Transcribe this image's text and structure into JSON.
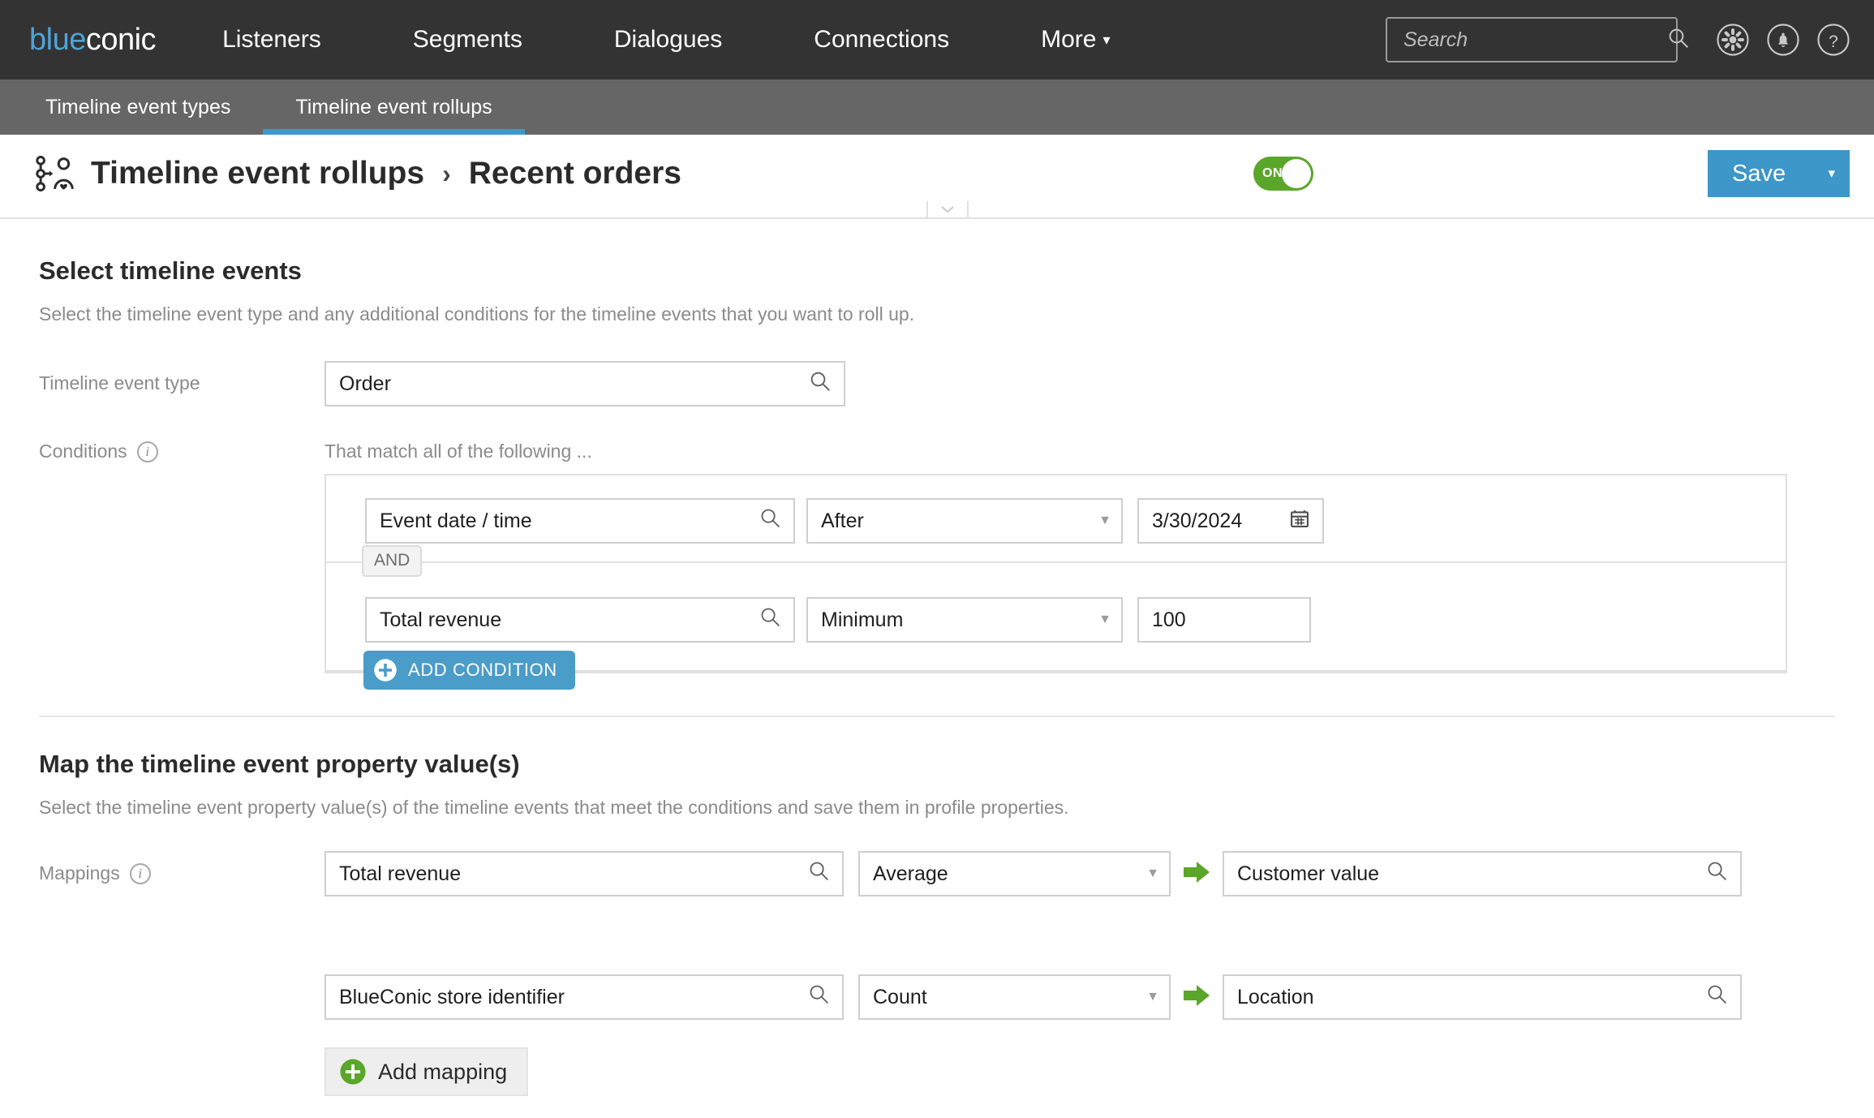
{
  "topnav": {
    "logo_blue": "blue",
    "logo_rest": "conic",
    "links": [
      {
        "label": "Listeners"
      },
      {
        "label": "Segments"
      },
      {
        "label": "Dialogues"
      },
      {
        "label": "Connections"
      },
      {
        "label": "More"
      }
    ],
    "more_caret": "▾",
    "search": {
      "value": "",
      "placeholder": "Search",
      "icon": "search-icon"
    },
    "icons": [
      "gear-icon",
      "bell-icon",
      "help-icon"
    ]
  },
  "tabs": [
    {
      "label": "Timeline event types",
      "active": false
    },
    {
      "label": "Timeline event rollups",
      "active": true
    }
  ],
  "page_header": {
    "breadcrumb_root": "Timeline event rollups",
    "breadcrumb_sep": "›",
    "breadcrumb_current": "Recent orders",
    "toggle": {
      "label": "ON",
      "state": "on"
    },
    "save": {
      "label": "Save",
      "caret": "▾"
    }
  },
  "select_events": {
    "title": "Select timeline events",
    "subtitle": "Select the timeline event type and any additional conditions for the timeline events that you want to roll up.",
    "event_type": {
      "label": "Timeline event type",
      "value": "Order"
    },
    "conditions": {
      "label": "Conditions",
      "match_text": "That match all of the following ...",
      "joiner": "AND",
      "rows": [
        {
          "property": "Event date / time",
          "operator": "After",
          "value": "3/30/2024",
          "value_kind": "date"
        },
        {
          "property": "Total revenue",
          "operator": "Minimum",
          "value": "100",
          "value_kind": "number"
        }
      ],
      "add_button": "ADD CONDITION"
    }
  },
  "map_values": {
    "title": "Map the timeline event property value(s)",
    "subtitle": "Select the timeline event property value(s) of the timeline events that meet the conditions and save them in profile properties.",
    "label": "Mappings",
    "rows": [
      {
        "source": "Total revenue",
        "operation": "Average",
        "target": "Customer value"
      },
      {
        "source": "BlueConic store identifier",
        "operation": "Count",
        "target": "Location"
      }
    ],
    "add_button": "Add mapping"
  },
  "colors": {
    "brand_blue": "#4098c8",
    "topbar": "#333333",
    "tabbar": "#666666",
    "toggle_green": "#5aa62a",
    "arrow_green": "#5aa62a",
    "save_blue": "#3d97c8"
  }
}
